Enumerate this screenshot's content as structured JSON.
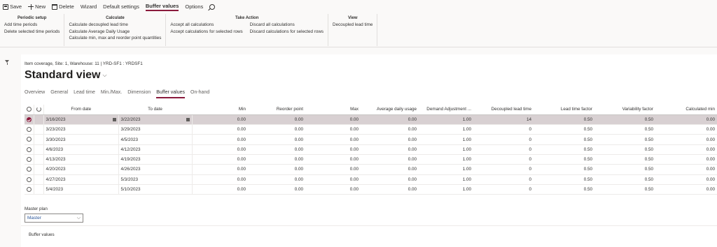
{
  "cmdbar": {
    "save": "Save",
    "new": "New",
    "delete": "Delete",
    "wizard": "Wizard",
    "default_settings": "Default settings",
    "buffer_values": "Buffer values",
    "options": "Options"
  },
  "ribbon": {
    "periodic": {
      "title": "Periodic setup",
      "items": [
        "Add time periods",
        "Delete selected time periods"
      ]
    },
    "calculate": {
      "title": "Calculate",
      "items": [
        "Calculate decoupled lead time",
        "Calculate Average Daily Usage",
        "Calculate min, max and reorder point quantities"
      ]
    },
    "take_action": {
      "title": "Take Action",
      "col1": [
        "Accept all calculations",
        "Accept calculations for selected rows"
      ],
      "col2": [
        "Discard all calculations",
        "Discard calculations for selected rows"
      ]
    },
    "view": {
      "title": "View",
      "items": [
        "Decoupled lead time"
      ]
    }
  },
  "page": {
    "caption": "Item coverage, Site: 1, Warehouse: 11  |  YRD-SF1 : YRDSF1",
    "title": "Standard view"
  },
  "tabs": [
    "Overview",
    "General",
    "Lead time",
    "Min./Max.",
    "Dimension",
    "Buffer values",
    "On-hand"
  ],
  "grid": {
    "headers": [
      "From date",
      "To date",
      "Min",
      "Reorder point",
      "Max",
      "Average daily usage",
      "Demand Adjustment ...",
      "Decoupled lead time",
      "Lead time factor",
      "Variability factor",
      "Calculated min"
    ],
    "rows": [
      [
        "3/16/2023",
        "3/22/2023",
        "0.00",
        "0.00",
        "0.00",
        "0.00",
        "1.00",
        "14",
        "0.50",
        "0.50",
        "0.00"
      ],
      [
        "3/23/2023",
        "3/29/2023",
        "0.00",
        "0.00",
        "0.00",
        "0.00",
        "1.00",
        "0",
        "0.50",
        "0.50",
        "0.00"
      ],
      [
        "3/30/2023",
        "4/5/2023",
        "0.00",
        "0.00",
        "0.00",
        "0.00",
        "1.00",
        "0",
        "0.50",
        "0.50",
        "0.00"
      ],
      [
        "4/6/2023",
        "4/12/2023",
        "0.00",
        "0.00",
        "0.00",
        "0.00",
        "1.00",
        "0",
        "0.50",
        "0.50",
        "0.00"
      ],
      [
        "4/13/2023",
        "4/19/2023",
        "0.00",
        "0.00",
        "0.00",
        "0.00",
        "1.00",
        "0",
        "0.50",
        "0.50",
        "0.00"
      ],
      [
        "4/20/2023",
        "4/26/2023",
        "0.00",
        "0.00",
        "0.00",
        "0.00",
        "1.00",
        "0",
        "0.50",
        "0.50",
        "0.00"
      ],
      [
        "4/27/2023",
        "5/3/2023",
        "0.00",
        "0.00",
        "0.00",
        "0.00",
        "1.00",
        "0",
        "0.50",
        "0.50",
        "0.00"
      ],
      [
        "5/4/2023",
        "5/10/2023",
        "0.00",
        "0.00",
        "0.00",
        "0.00",
        "1.00",
        "0",
        "0.50",
        "0.50",
        "0.00"
      ]
    ]
  },
  "master_plan": {
    "label": "Master plan",
    "value": "Master"
  },
  "section": {
    "title": "Buffer values"
  },
  "colors": {
    "accent": "#8a1a3c",
    "selected_row": "#d8d0d2"
  }
}
